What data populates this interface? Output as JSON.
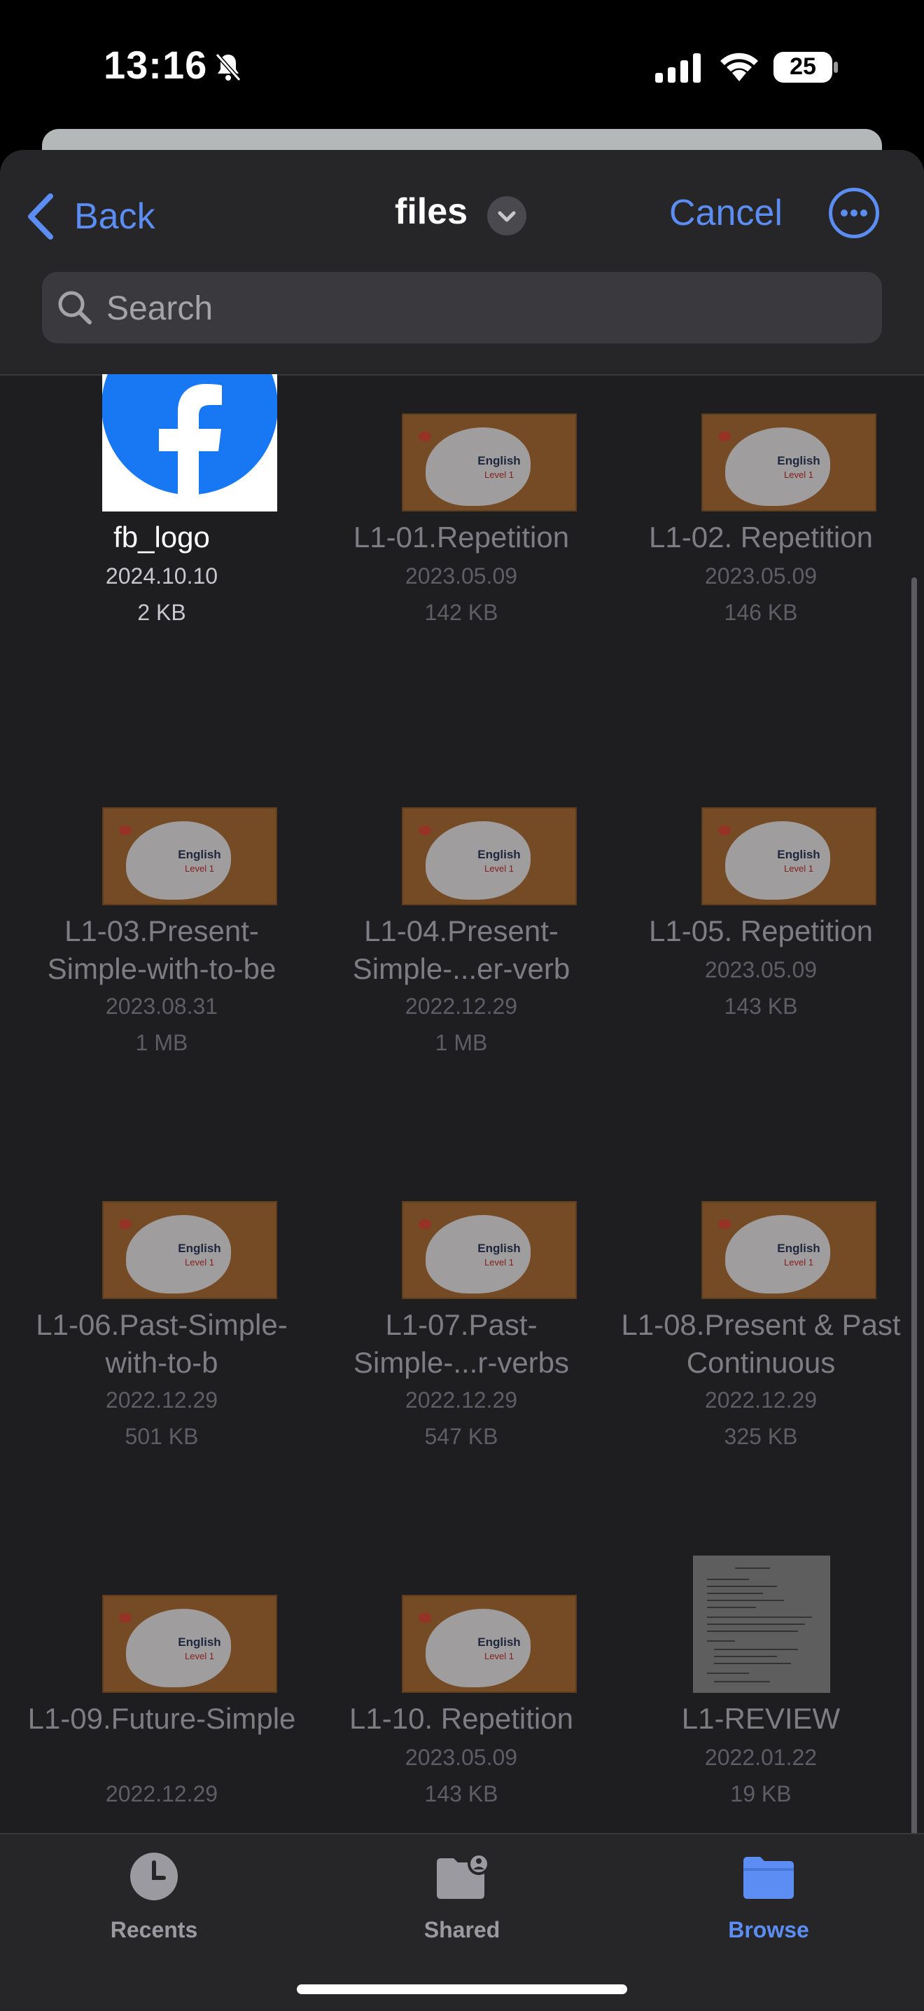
{
  "status": {
    "time": "13:16",
    "battery": "25"
  },
  "nav": {
    "back_label": "Back",
    "title": "files",
    "cancel_label": "Cancel"
  },
  "search": {
    "placeholder": "Search"
  },
  "thumb_text": {
    "line1": "English",
    "line2": "Level 1"
  },
  "files": [
    {
      "name": "fb_logo",
      "date": "2024.10.10",
      "size": "2 KB",
      "thumb": "facebook-logo"
    },
    {
      "name": "L1-01.Repetition",
      "date": "2023.05.09",
      "size": "142 KB",
      "thumb": "english-level-1"
    },
    {
      "name": "L1-02. Repetition",
      "date": "2023.05.09",
      "size": "146 KB",
      "thumb": "english-level-1"
    },
    {
      "name": "L1-03.Present-Simple-with-to-be",
      "date": "2023.08.31",
      "size": "1 MB",
      "thumb": "english-level-1"
    },
    {
      "name": "L1-04.Present-Simple-...er-verb",
      "date": "2022.12.29",
      "size": "1 MB",
      "thumb": "english-level-1"
    },
    {
      "name": "L1-05. Repetition",
      "date": "2023.05.09",
      "size": "143 KB",
      "thumb": "english-level-1"
    },
    {
      "name": "L1-06.Past-Simple-with-to-b",
      "date": "2022.12.29",
      "size": "501 KB",
      "thumb": "english-level-1"
    },
    {
      "name": "L1-07.Past-Simple-...r-verbs",
      "date": "2022.12.29",
      "size": "547 KB",
      "thumb": "english-level-1"
    },
    {
      "name": "L1-08.Present & Past Continuous",
      "date": "2022.12.29",
      "size": "325 KB",
      "thumb": "english-level-1"
    },
    {
      "name": "L1-09.Future-Simple",
      "date": "2022.12.29",
      "size": "",
      "thumb": "english-level-1"
    },
    {
      "name": "L1-10. Repetition",
      "date": "2023.05.09",
      "size": "143 KB",
      "thumb": "english-level-1"
    },
    {
      "name": "L1-REVIEW",
      "date": "2022.01.22",
      "size": "19 KB",
      "thumb": "document-page"
    }
  ],
  "tabs": [
    {
      "label": "Recents",
      "icon": "clock-icon"
    },
    {
      "label": "Shared",
      "icon": "shared-folder-icon"
    },
    {
      "label": "Browse",
      "icon": "folder-icon",
      "selected": true
    }
  ],
  "colors": {
    "accent": "#5c8df3",
    "background": "#1e1e20"
  }
}
